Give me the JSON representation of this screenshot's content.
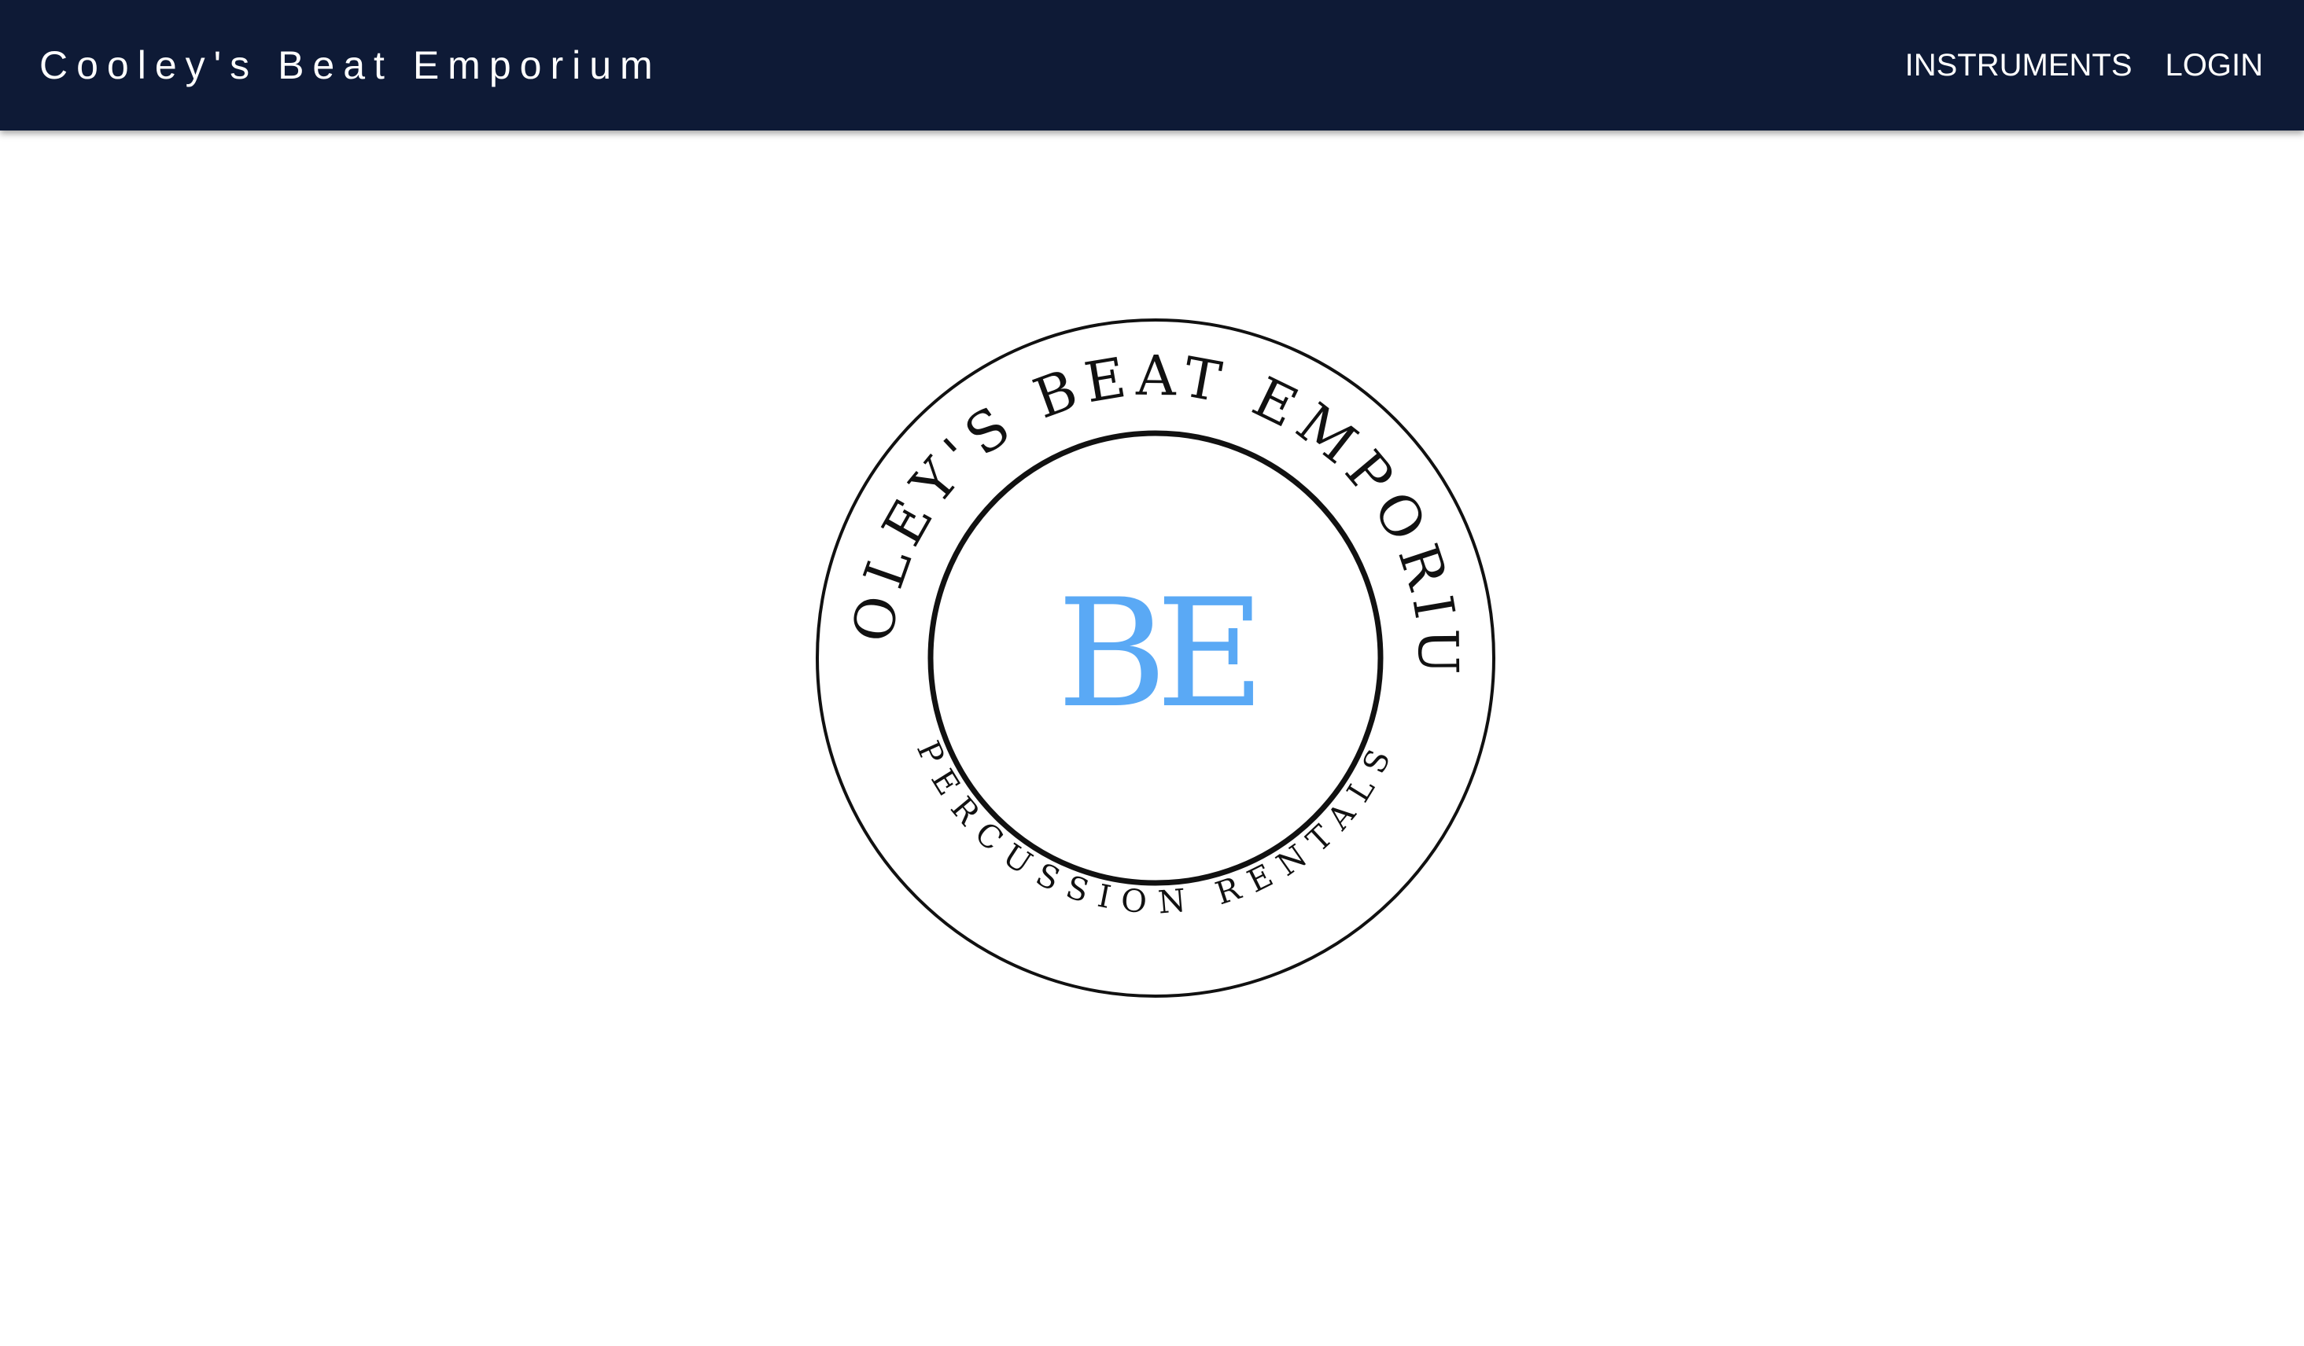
{
  "navbar": {
    "brand": "Cooley's Beat Emporium",
    "links": [
      {
        "label": "INSTRUMENTS"
      },
      {
        "label": "LOGIN"
      }
    ],
    "background_color": "#0e1a36"
  },
  "logo": {
    "ring_top_text": "COOLEY'S BEAT EMPORIUM",
    "ring_bottom_text": "PERCUSSION RENTALS",
    "monogram": "BE",
    "monogram_color": "#5aa9f5"
  }
}
